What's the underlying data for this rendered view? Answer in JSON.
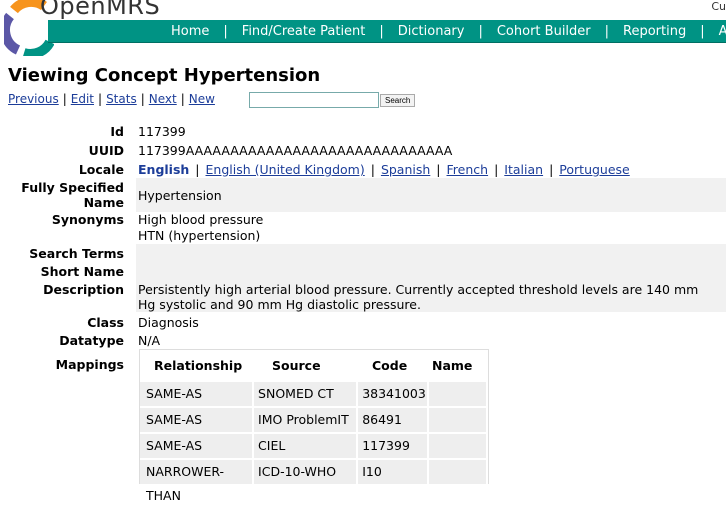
{
  "header": {
    "brand": "OpenMRS",
    "user_link": "Cu",
    "nav": [
      "Home",
      "Find/Create Patient",
      "Dictionary",
      "Cohort Builder",
      "Reporting",
      "A"
    ]
  },
  "page": {
    "title": "Viewing Concept Hypertension",
    "actions": [
      "Previous",
      "Edit",
      "Stats",
      "Next",
      "New"
    ],
    "search_value": "",
    "search_button": "Search"
  },
  "fields": {
    "id_label": "Id",
    "id_value": "117399",
    "uuid_label": "UUID",
    "uuid_value": "117399AAAAAAAAAAAAAAAAAAAAAAAAAAAAAA",
    "locale_label": "Locale",
    "locale_current": "English",
    "locale_links": [
      "English (United Kingdom)",
      "Spanish",
      "French",
      "Italian",
      "Portuguese"
    ],
    "fsn_label_1": "Fully Specified",
    "fsn_label_2": "Name",
    "fsn_value": "Hypertension",
    "synonyms_label": "Synonyms",
    "synonym_1": "High blood pressure",
    "synonym_2": "HTN (hypertension)",
    "search_terms_label": "Search Terms",
    "short_name_label": "Short Name",
    "description_label": "Description",
    "description_value": "Persistently high arterial blood pressure. Currently accepted threshold levels are 140 mm Hg systolic and 90 mm Hg diastolic pressure.",
    "class_label": "Class",
    "class_value": "Diagnosis",
    "datatype_label": "Datatype",
    "datatype_value": "N/A",
    "mappings_label": "Mappings"
  },
  "mappings": {
    "headers": [
      "Relationship",
      "Source",
      "Code",
      "Name"
    ],
    "rows": [
      [
        "SAME-AS",
        "SNOMED CT",
        "38341003",
        ""
      ],
      [
        "SAME-AS",
        "IMO ProblemIT",
        "86491",
        ""
      ],
      [
        "SAME-AS",
        "CIEL",
        "117399",
        ""
      ],
      [
        "NARROWER-THAN",
        "ICD-10-WHO",
        "I10",
        ""
      ]
    ]
  },
  "colors": {
    "nav": "#009384",
    "link": "#1c3d99",
    "logo_orange": "#f7941d",
    "logo_purple": "#5b57a6",
    "logo_teal": "#009384"
  }
}
